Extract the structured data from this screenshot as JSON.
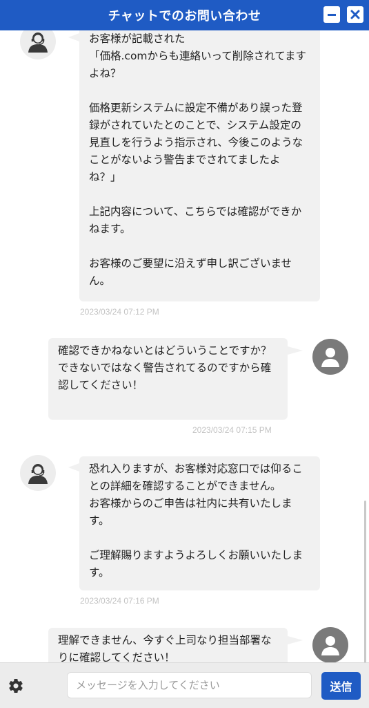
{
  "header": {
    "title": "チャットでのお問い合わせ",
    "minimize_icon": "minimize-icon",
    "close_icon": "close-icon"
  },
  "messages": [
    {
      "sender": "agent",
      "text": "お客様が記載された\n「価格.comからも連絡いって削除されてますよね？\n\n価格更新システムに設定不備があり誤った登録がされていたとのことで、システム設定の見直しを行うよう指示され、今後このようなことがないよう警告までされてましたよね？」\n\n上記内容について、こちらでは確認ができかねます。\n\nお客様のご要望に沿えず申し訳ございません。",
      "timestamp": "2023/03/24 07:12 PM"
    },
    {
      "sender": "user",
      "text": "確認できかねないとはどういうことですか？\nできないではなく警告されてるのですから確認してください！",
      "timestamp": "2023/03/24 07:15 PM"
    },
    {
      "sender": "agent",
      "text": "恐れ入りますが、お客様対応窓口では仰ることの詳細を確認することができません。\nお客様からのご申告は社内に共有いたします。\n\nご理解賜りますようよろしくお願いいたします。",
      "timestamp": "2023/03/24 07:16 PM"
    },
    {
      "sender": "user",
      "text": "理解できません、今すぐ上司なり担当部署なりに確認してください！",
      "timestamp": ""
    }
  ],
  "footer": {
    "settings_icon": "gear-icon",
    "input_placeholder": "メッセージを入力してください",
    "input_value": "",
    "send_label": "送信"
  },
  "colors": {
    "brand_blue": "#1f5bc4",
    "bubble_bg": "#f1f1f1",
    "timestamp": "#c3c3c3",
    "footer_bg": "#ececec"
  }
}
